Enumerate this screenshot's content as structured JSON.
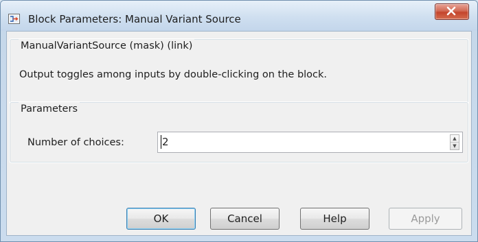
{
  "window": {
    "title": "Block Parameters: Manual Variant Source",
    "close_icon": "close-icon"
  },
  "mask_group": {
    "label": "ManualVariantSource (mask) (link)",
    "description": "Output toggles among inputs by double-clicking on the block."
  },
  "parameters_group": {
    "label": "Parameters",
    "fields": [
      {
        "label": "Number of choices:",
        "value": "2"
      }
    ]
  },
  "buttons": {
    "ok": "OK",
    "cancel": "Cancel",
    "help": "Help",
    "apply": "Apply"
  },
  "colors": {
    "titlebar": "#cfdff0",
    "close_button": "#c3452d",
    "client_bg": "#f0f0f0",
    "default_button_border": "#3c7fb1"
  }
}
